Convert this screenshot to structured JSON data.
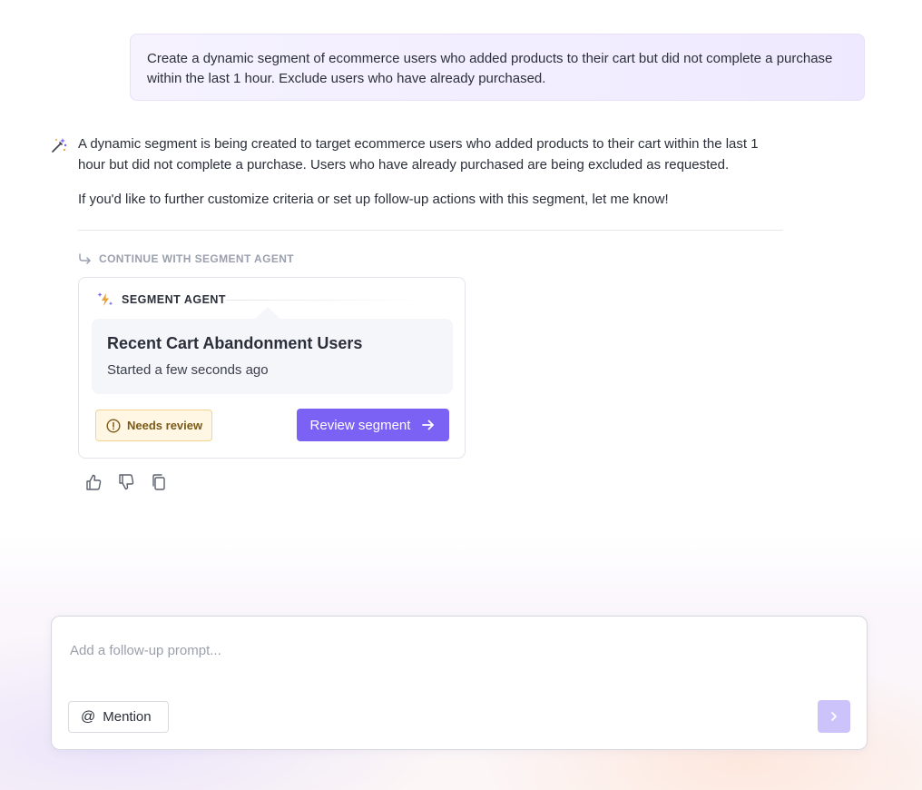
{
  "user_message": "Create a dynamic segment of ecommerce users who added products to their cart but did not complete a purchase within the last 1 hour. Exclude users who have already purchased.",
  "assistant": {
    "paragraph_1": "A dynamic segment is being created to target ecommerce users who added products to their cart within the last 1 hour but did not complete a purchase. Users who have already purchased are being excluded as requested.",
    "paragraph_2": "If you'd like to further customize criteria or set up follow-up actions with this segment, let me know!"
  },
  "continue_label": "CONTINUE WITH SEGMENT AGENT",
  "agent_card": {
    "header": "SEGMENT AGENT",
    "segment_title": "Recent Cart Abandonment Users",
    "segment_status": "Started a few seconds ago",
    "badge_label": "Needs review",
    "review_button": "Review segment"
  },
  "feedback_icons": [
    "thumbs-up-icon",
    "thumbs-down-icon",
    "copy-icon"
  ],
  "composer": {
    "placeholder": "Add a follow-up prompt...",
    "value": "",
    "mention_label": "Mention",
    "mention_symbol": "@"
  },
  "colors": {
    "accent": "#7b61f4",
    "send_disabled": "#cdc3fb",
    "badge_bg": "#fff6e3",
    "badge_border": "#f3d48f",
    "user_bubble": "#f3efff"
  }
}
